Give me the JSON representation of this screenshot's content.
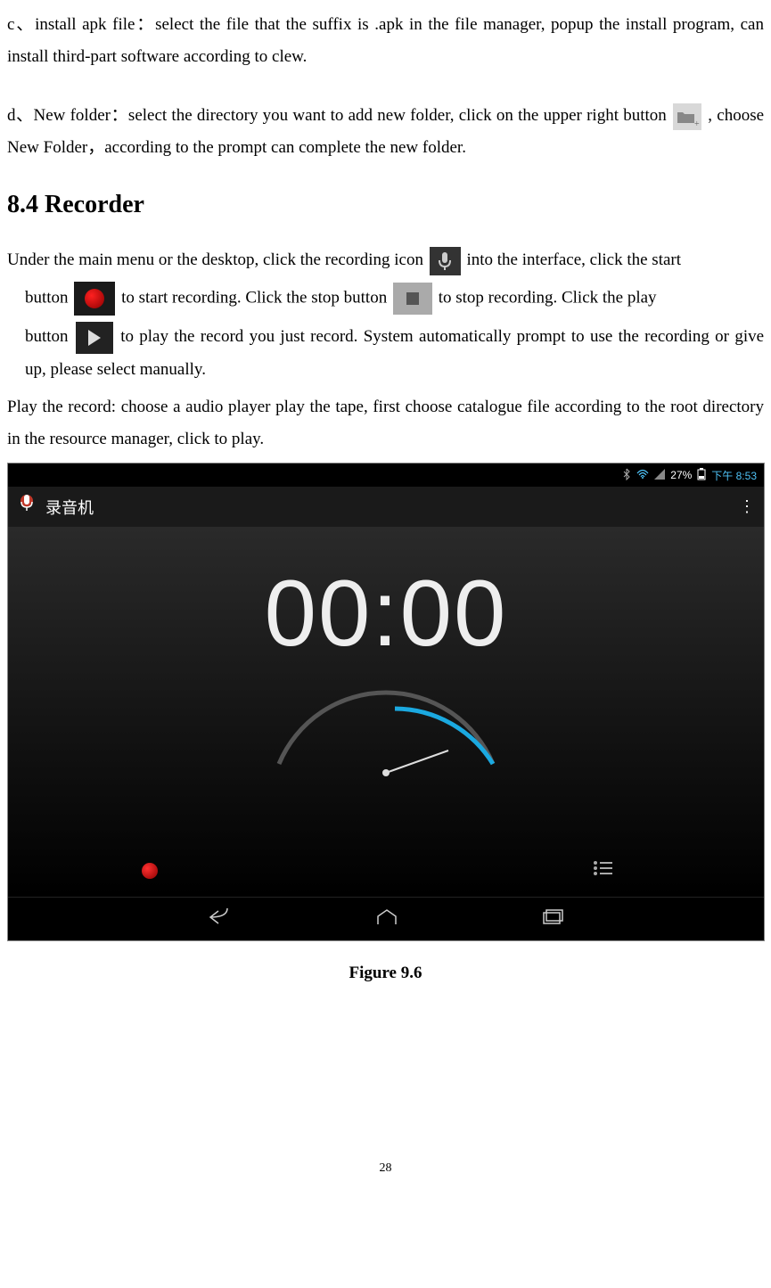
{
  "paragraphs": {
    "c_part_a": "c、install apk file：select the file that the suffix is .apk in the file manager, popup the install program, can install third-part software according to clew.",
    "d_part_a": "d、New folder：select the directory you want to add new folder, click on the upper right button",
    "d_part_b": ", choose New Folder，according to the prompt can complete the new folder."
  },
  "section_title": "8.4 Recorder",
  "recorder_text": {
    "line1_a": "Under the main menu or the desktop, click the recording icon",
    "line1_b": "into the interface, click the start",
    "line2_a": "button",
    "line2_b": "to start recording. Click the stop button",
    "line2_c": "to stop recording. Click the play",
    "line3_a": "button",
    "line3_b": "to play the record you just record. System  automatically prompt to use the recording or give up, please select manually.",
    "play_record": "Play the record: choose a audio player play the tape, first choose catalogue file according to the root directory in the resource manager, click to play."
  },
  "screenshot": {
    "status": {
      "battery": "27%",
      "time": "下午 8:53"
    },
    "app_title": "录音机",
    "timer": "00:00"
  },
  "figure_caption": "Figure 9.6",
  "page_number": "28"
}
